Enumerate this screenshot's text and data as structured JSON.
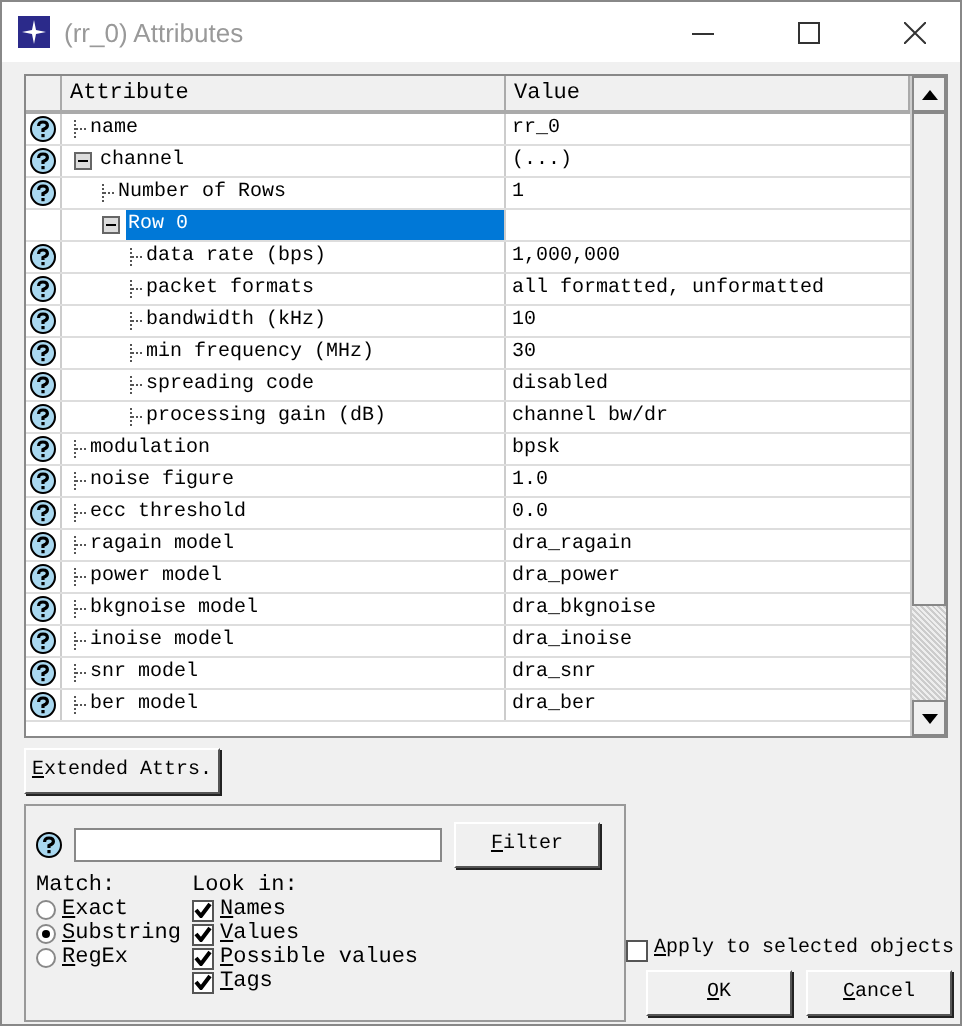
{
  "window": {
    "title": "(rr_0) Attributes"
  },
  "table": {
    "columns": [
      "Attribute",
      "Value"
    ],
    "rows": [
      {
        "name": "name",
        "value": "rr_0",
        "help": true,
        "selected": false
      },
      {
        "name": "channel",
        "value": "(...)",
        "help": true,
        "selected": false,
        "expanded": true,
        "children": [
          {
            "name": "Number of Rows",
            "value": "1",
            "help": true,
            "selected": false
          },
          {
            "name": "Row 0",
            "help": false,
            "selected": true,
            "expanded": true,
            "children": [
              {
                "name": "data rate (bps)",
                "value": "1,000,000",
                "help": true,
                "selected": false
              },
              {
                "name": "packet formats",
                "value": "all formatted, unformatted",
                "help": true,
                "selected": false
              },
              {
                "name": "bandwidth (kHz)",
                "value": "10",
                "help": true,
                "selected": false
              },
              {
                "name": "min frequency (MHz)",
                "value": "30",
                "help": true,
                "selected": false
              },
              {
                "name": "spreading code",
                "value": "disabled",
                "help": true,
                "selected": false
              },
              {
                "name": "processing gain (dB)",
                "value": "channel bw/dr",
                "help": true,
                "selected": false
              }
            ]
          }
        ]
      },
      {
        "name": "modulation",
        "value": "bpsk",
        "help": true,
        "selected": false
      },
      {
        "name": "noise figure",
        "value": "1.0",
        "help": true,
        "selected": false
      },
      {
        "name": "ecc threshold",
        "value": "0.0",
        "help": true,
        "selected": false
      },
      {
        "name": "ragain model",
        "value": "dra_ragain",
        "help": true,
        "selected": false
      },
      {
        "name": "power model",
        "value": "dra_power",
        "help": true,
        "selected": false
      },
      {
        "name": "bkgnoise model",
        "value": "dra_bkgnoise",
        "help": true,
        "selected": false
      },
      {
        "name": "inoise model",
        "value": "dra_inoise",
        "help": true,
        "selected": false
      },
      {
        "name": "snr model",
        "value": "dra_snr",
        "help": true,
        "selected": false
      },
      {
        "name": "ber model",
        "value": "dra_ber",
        "help": true,
        "selected": false
      }
    ]
  },
  "extended_button": "Extended Attrs.",
  "filter": {
    "button": "Filter",
    "match_label": "Match:",
    "match": [
      {
        "label": "Exact",
        "selected": false
      },
      {
        "label": "Substring",
        "selected": true
      },
      {
        "label": "RegEx",
        "selected": false
      }
    ],
    "look_in_label": "Look in:",
    "look_in": [
      {
        "label": "Names",
        "checked": true
      },
      {
        "label": "Values",
        "checked": true
      },
      {
        "label": "Possible values",
        "checked": true
      },
      {
        "label": "Tags",
        "checked": true
      }
    ]
  },
  "apply": {
    "label": "Apply to selected objects",
    "checked": false
  },
  "buttons": [
    "OK",
    "Cancel"
  ]
}
